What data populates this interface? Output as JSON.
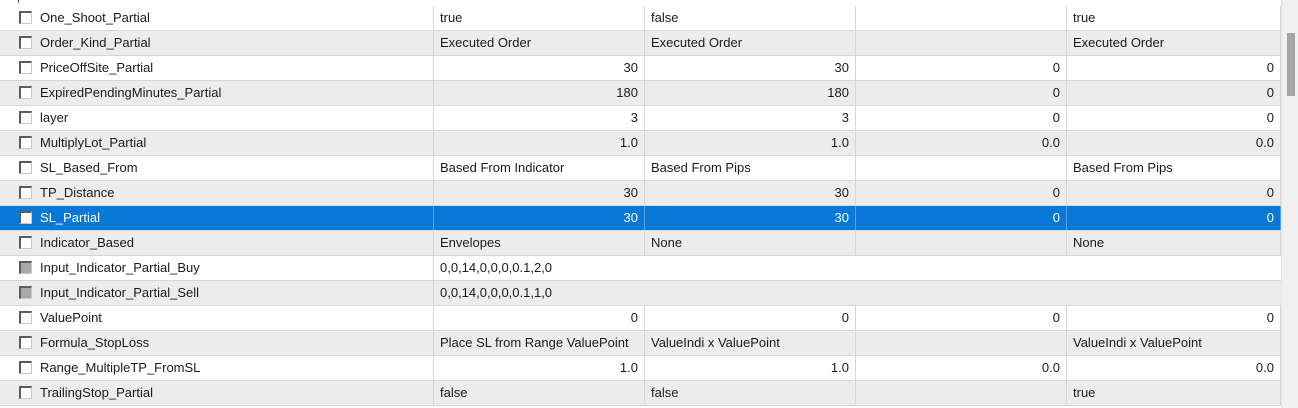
{
  "colors": {
    "selection_bg": "#0a78d7",
    "row_alt_bg": "#ececec",
    "grid_line": "#d6d6d6"
  },
  "rows": [
    {
      "name": "One_Shoot_Partial",
      "checkbox": "unchecked",
      "values": [
        "true",
        "false",
        "",
        "true"
      ],
      "align": "text"
    },
    {
      "name": "Order_Kind_Partial",
      "checkbox": "unchecked",
      "values": [
        "Executed Order",
        "Executed Order",
        "",
        "Executed Order"
      ],
      "align": "text"
    },
    {
      "name": "PriceOffSite_Partial",
      "checkbox": "unchecked",
      "values": [
        "30",
        "30",
        "0",
        "0"
      ],
      "align": "number"
    },
    {
      "name": "ExpiredPendingMinutes_Partial",
      "checkbox": "unchecked",
      "values": [
        "180",
        "180",
        "0",
        "0"
      ],
      "align": "number"
    },
    {
      "name": "layer",
      "checkbox": "unchecked",
      "values": [
        "3",
        "3",
        "0",
        "0"
      ],
      "align": "number"
    },
    {
      "name": "MultiplyLot_Partial",
      "checkbox": "unchecked",
      "values": [
        "1.0",
        "1.0",
        "0.0",
        "0.0"
      ],
      "align": "number"
    },
    {
      "name": "SL_Based_From",
      "checkbox": "unchecked",
      "values": [
        "Based From Indicator",
        "Based From Pips",
        "",
        "Based From Pips"
      ],
      "align": "text"
    },
    {
      "name": "TP_Distance",
      "checkbox": "unchecked",
      "values": [
        "30",
        "30",
        "0",
        "0"
      ],
      "align": "number"
    },
    {
      "name": "SL_Partial",
      "checkbox": "unchecked",
      "values": [
        "30",
        "30",
        "0",
        "0"
      ],
      "align": "number",
      "selected": true
    },
    {
      "name": "Indicator_Based",
      "checkbox": "unchecked",
      "values": [
        "Envelopes",
        "None",
        "",
        "None"
      ],
      "align": "text"
    },
    {
      "name": "Input_Indicator_Partial_Buy",
      "checkbox": "grayed",
      "wide_value": "0,0,14,0,0,0,0.1,2,0",
      "align": "text"
    },
    {
      "name": "Input_Indicator_Partial_Sell",
      "checkbox": "grayed",
      "wide_value": "0,0,14,0,0,0,0.1,1,0",
      "align": "text"
    },
    {
      "name": "ValuePoint",
      "checkbox": "unchecked",
      "values": [
        "0",
        "0",
        "0",
        "0"
      ],
      "align": "number"
    },
    {
      "name": "Formula_StopLoss",
      "checkbox": "unchecked",
      "values": [
        "Place SL from Range ValuePoint",
        "ValueIndi x ValuePoint",
        "",
        "ValueIndi x ValuePoint"
      ],
      "align": "text"
    },
    {
      "name": "Range_MultipleTP_FromSL",
      "checkbox": "unchecked",
      "values": [
        "1.0",
        "1.0",
        "0.0",
        "0.0"
      ],
      "align": "number"
    },
    {
      "name": "TrailingStop_Partial",
      "checkbox": "unchecked",
      "values": [
        "false",
        "false",
        "",
        "true"
      ],
      "align": "text"
    }
  ]
}
